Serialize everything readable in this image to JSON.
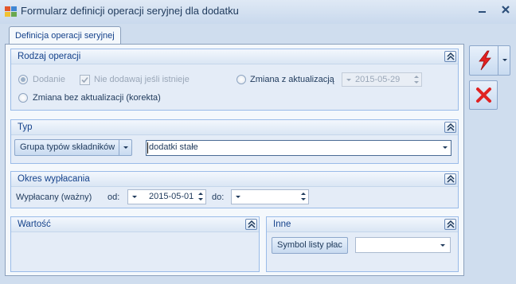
{
  "window": {
    "title": "Formularz definicji operacji seryjnej dla dodatku"
  },
  "tab": {
    "label": "Definicja operacji seryjnej"
  },
  "rodzaj": {
    "title": "Rodzaj operacji",
    "dodanie_label": "Dodanie",
    "nie_dodawaj_label": "Nie dodawaj jeśli istnieje",
    "zmiana_z_akt_label": "Zmiana z aktualizacją",
    "zmiana_date": "2015-05-29",
    "zmiana_bez_label": "Zmiana bez aktualizacji (korekta)"
  },
  "typ": {
    "title": "Typ",
    "selector_label": "Grupa typów składników",
    "value": "dodatki stałe"
  },
  "okres": {
    "title": "Okres wypłacania",
    "row_label": "Wypłacany (ważny)",
    "od_label": "od:",
    "od_value": "2015-05-01",
    "do_label": "do:",
    "do_value": ""
  },
  "wartosc": {
    "title": "Wartość"
  },
  "inne": {
    "title": "Inne",
    "symbol_button": "Symbol listy płac",
    "symbol_value": ""
  }
}
